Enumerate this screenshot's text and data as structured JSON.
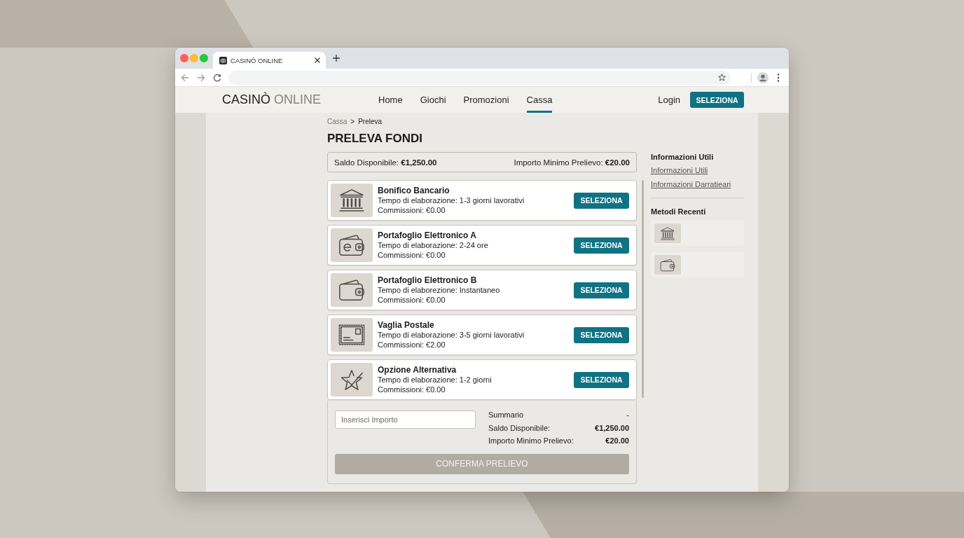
{
  "browser": {
    "tab_title": "CASINÒ ONLINE"
  },
  "header": {
    "logo": {
      "primary": "CASINÒ",
      "secondary": "ONLINE"
    },
    "nav": [
      {
        "label": "Home",
        "selected": false
      },
      {
        "label": "Giochi",
        "selected": false
      },
      {
        "label": "Promozioni",
        "selected": false
      },
      {
        "label": "Cassa",
        "selected": true
      }
    ],
    "login": "Login",
    "cta_button": "SELEZIONA"
  },
  "breadcrumb": {
    "separator": ">",
    "items": [
      {
        "label": "Cassa",
        "current": false
      },
      {
        "label": "Preleva",
        "current": true
      }
    ]
  },
  "page_title": "PRELEVA FONDI",
  "balance_bar": {
    "available": "Saldo Disponibile: **€1,250.00**",
    "minimum": "Importo Minimo Prelievo: **€20.00**"
  },
  "methods": [
    {
      "kind": "bank",
      "name": "Bonifico Bancario",
      "processing_time": "Tempo di elaborazione: 1-3 giorni lavorativi",
      "fee": "Commissioni: €0.00",
      "button": "SELEZIONA"
    },
    {
      "kind": "ewallet",
      "name": "Portafoglio Elettronico A",
      "processing_time": "Tempo di elaborazione: 2-24 ore",
      "fee": "Commissioni: €0.00",
      "button": "SELEZIONA"
    },
    {
      "kind": "wallet",
      "name": "Portafoglio Elettronico B",
      "processing_time": "Tempo di elaborezione: Instantaneo",
      "fee": "Commissioni: €0.00",
      "button": "SELEZIONA"
    },
    {
      "kind": "postal",
      "name": "Vaglia Postale",
      "processing_time": "Tempo di elaborazione: 3-5 giorni lavorativi",
      "fee": "Commissioni: €2.00",
      "button": "SELEZIONA"
    },
    {
      "kind": "star",
      "name": "Opzione Alternativa",
      "processing_time": "Tempo di elaborazione: 1-2 giorni",
      "fee": "Commissioni: €0.00",
      "button": "SELEZIONA"
    }
  ],
  "withdraw_form": {
    "amount_input": {
      "placeholder": "Inserisci Importo"
    },
    "summary": [
      {
        "kind": "heading",
        "label": "Summario",
        "value": "-"
      },
      {
        "kind": "amount",
        "label": "Saldo Disponibile:",
        "value": "€1,250.00"
      },
      {
        "kind": "amount",
        "label": "Importo Minimo Prelievo:",
        "value": "€20.00"
      }
    ],
    "confirm_button": {
      "label": "CONFERMA PRELIEVO",
      "disabled": true
    }
  },
  "sidebar": {
    "info_title": "Informazioni Utili",
    "links": [
      "Informazioni Utili",
      "Informazioni Darratieari"
    ],
    "recent_title": "Metodi Recenti",
    "recent_methods": [
      {
        "kind": "bank"
      },
      {
        "kind": "wallet"
      }
    ]
  }
}
